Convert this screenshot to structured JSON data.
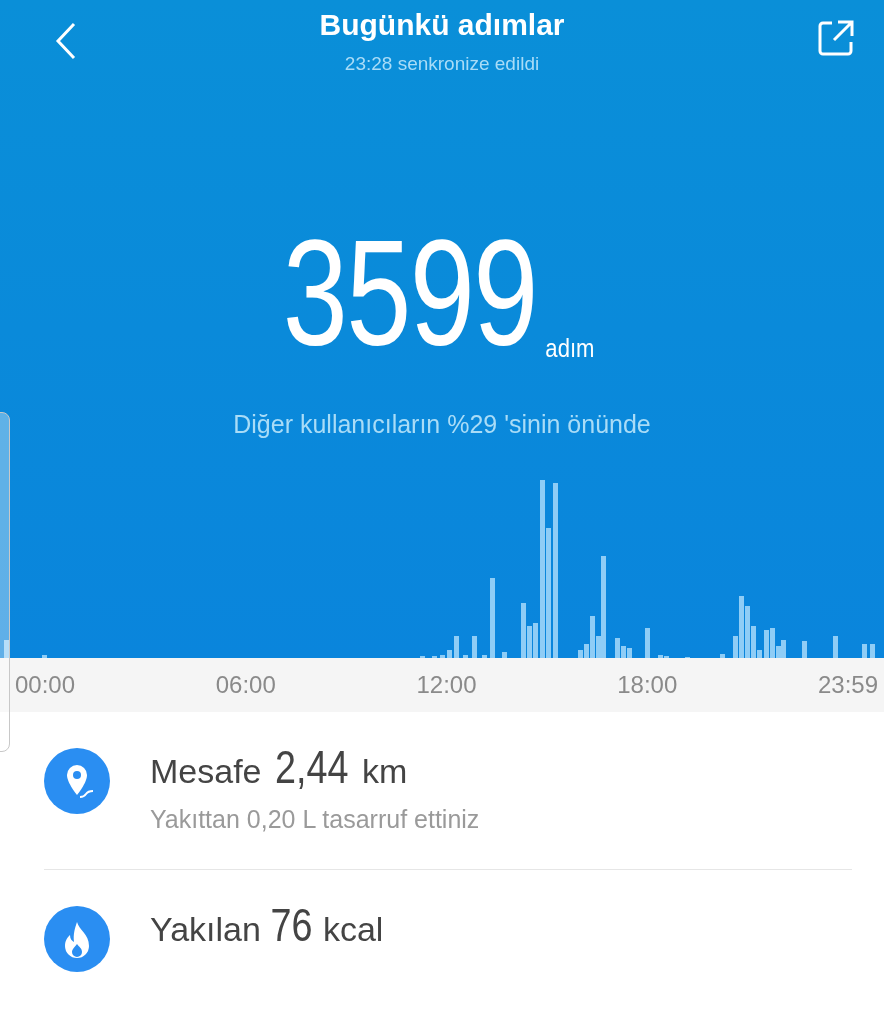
{
  "header": {
    "title": "Bugünkü adımlar",
    "subtitle": "23:28 senkronize edildi"
  },
  "steps": {
    "count": "3599",
    "unit": "adım",
    "comparison": "Diğer kullanıcıların %29 'sinin önünde"
  },
  "timeline": {
    "axis_labels": [
      "00:00",
      "06:00",
      "12:00",
      "18:00",
      "23:59"
    ]
  },
  "metrics": [
    {
      "kind": "distance",
      "label": "Mesafe",
      "value": "2,44",
      "unit": "km",
      "note": "Yakıttan 0,20 L tasarruf ettiniz"
    },
    {
      "kind": "calories",
      "label": "Yakılan",
      "value": "76",
      "unit": "kcal"
    }
  ]
}
